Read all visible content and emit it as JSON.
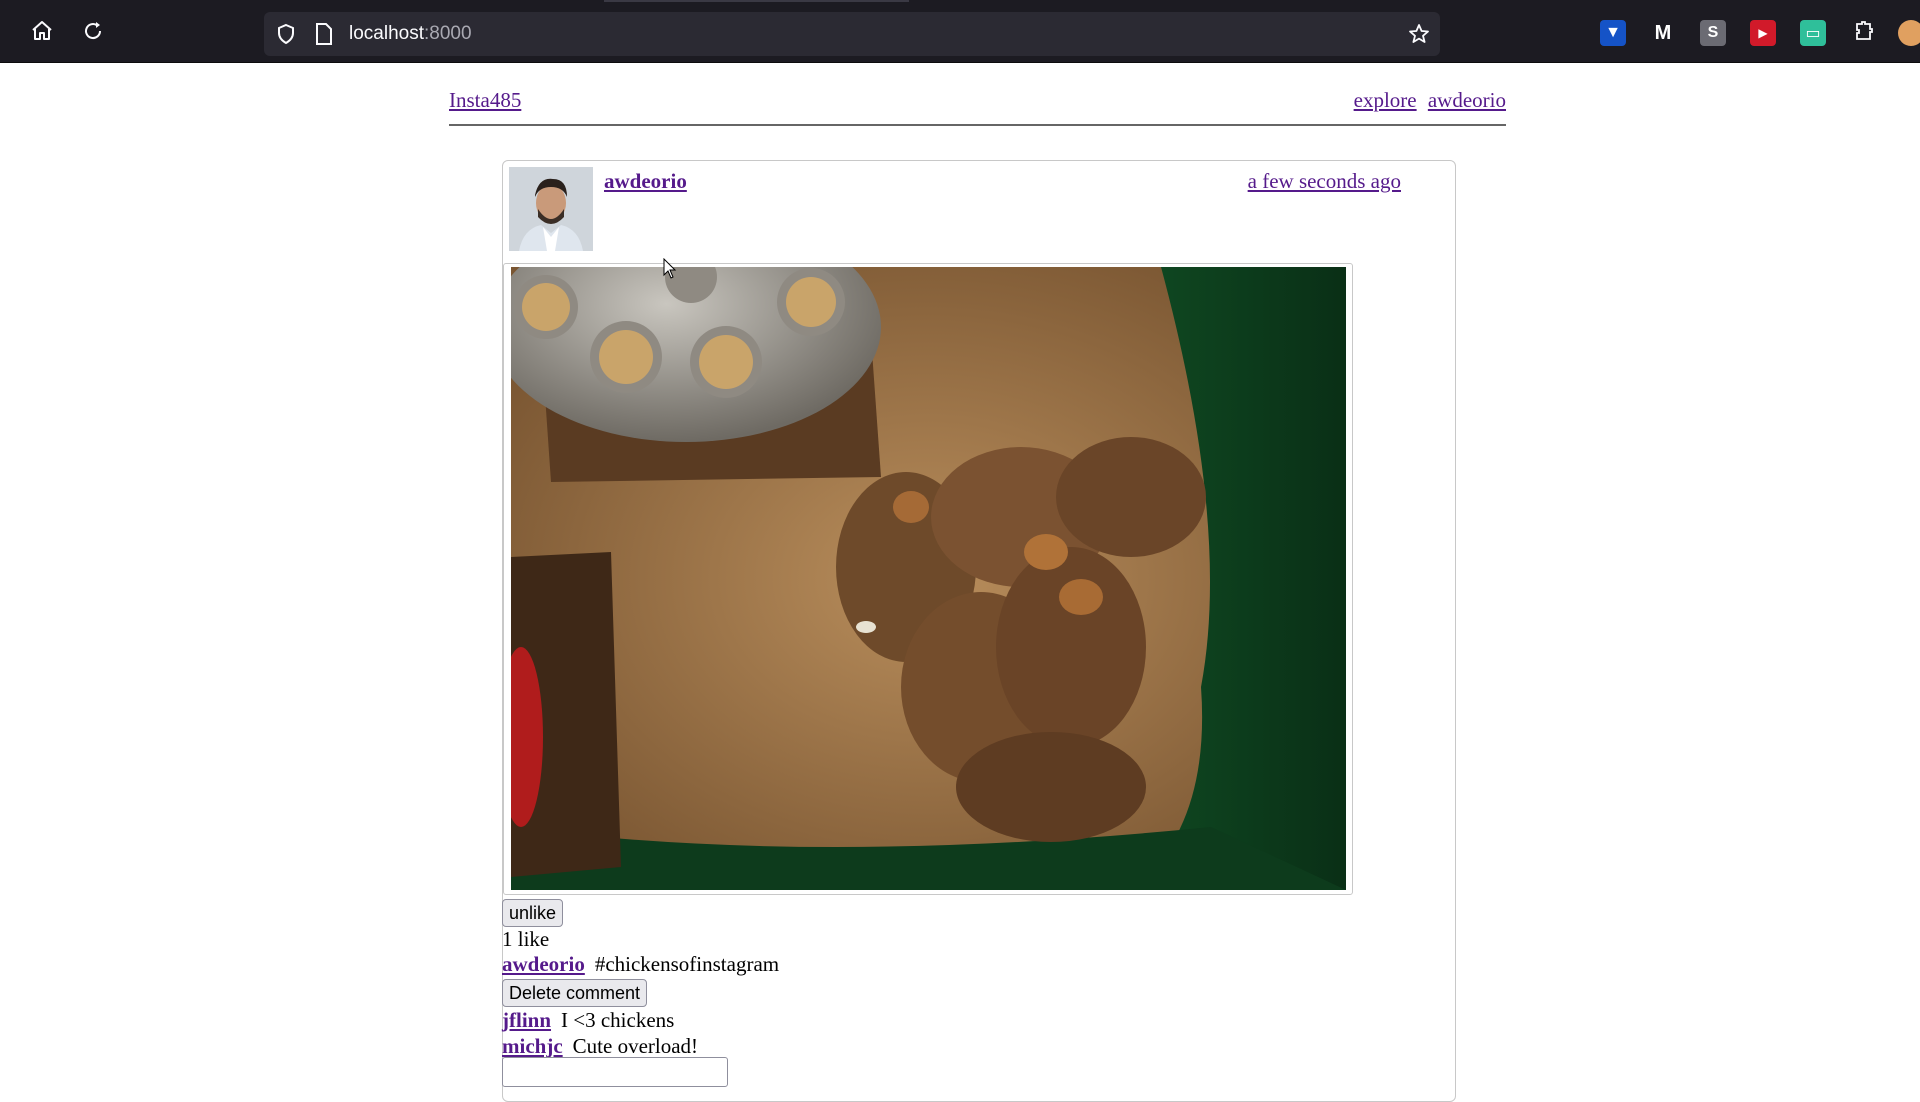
{
  "browser": {
    "url_host": "localhost",
    "url_port": ":8000",
    "icons": [
      "home-icon",
      "reload-icon",
      "shield-icon",
      "page-icon",
      "bookmark-star-icon",
      "extensions-icon"
    ]
  },
  "nav": {
    "brand": "Insta485",
    "explore": "explore",
    "user": "awdeorio"
  },
  "post": {
    "owner": "awdeorio",
    "timestamp": "a few seconds ago",
    "unlike_label": "unlike",
    "likes_text": "1 like",
    "comments": [
      {
        "owner": "awdeorio",
        "text": "#chickensofinstagram"
      },
      {
        "owner": "jflinn",
        "text": "I <3 chickens"
      },
      {
        "owner": "michjc",
        "text": "Cute overload!"
      }
    ],
    "delete_comment_label": "Delete comment"
  }
}
